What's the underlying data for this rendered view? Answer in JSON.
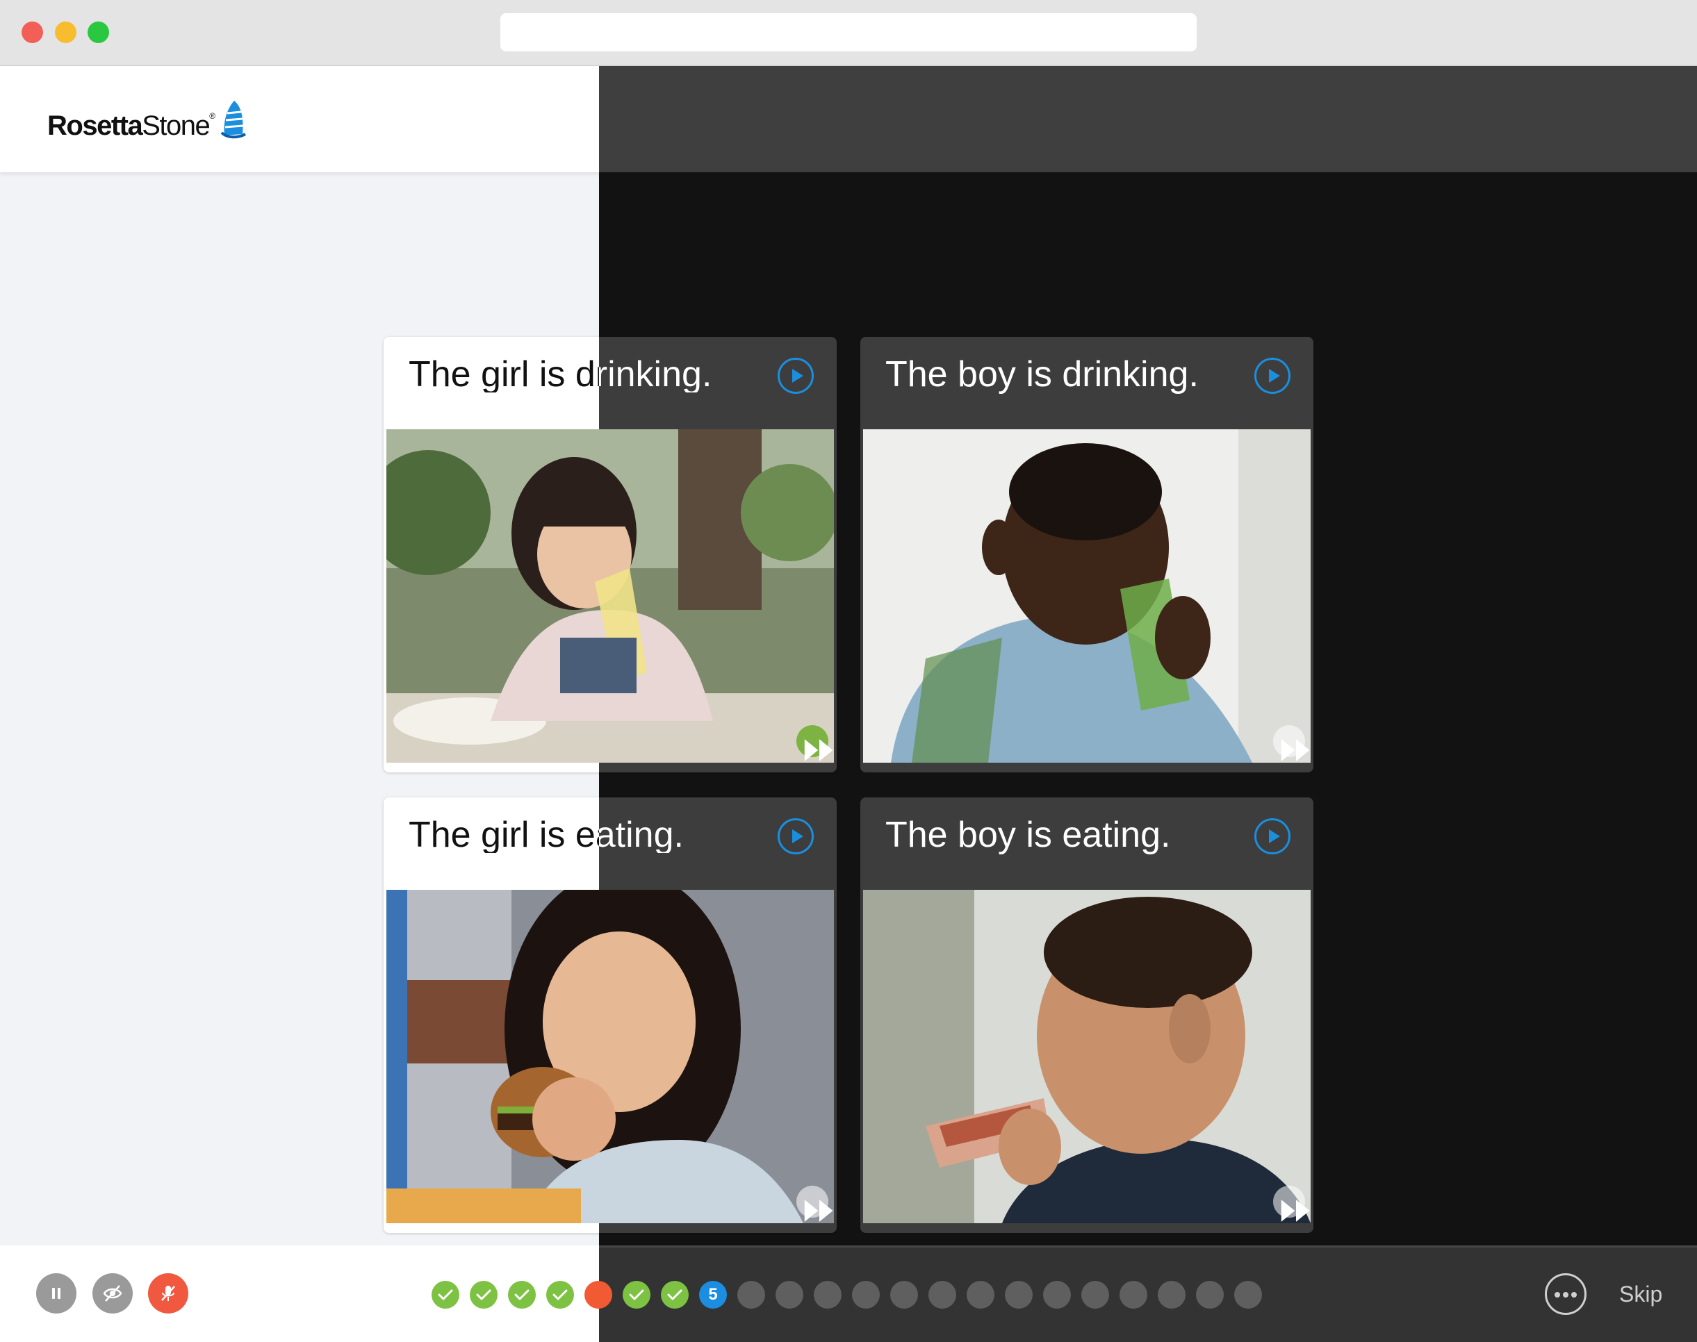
{
  "brand": {
    "logo_first": "Rosetta",
    "logo_second": "Stone",
    "logo_reg": "®",
    "accent_color": "#1b8ee2",
    "mark_color": "#1a8fe0"
  },
  "cards": [
    {
      "label": "The girl is drinking.",
      "play_icon": "play-circle-icon",
      "skip_icon": "fast-forward-icon"
    },
    {
      "label": "The boy is drinking.",
      "play_icon": "play-circle-icon",
      "skip_icon": "fast-forward-icon"
    },
    {
      "label": "The girl is eating.",
      "play_icon": "play-circle-icon",
      "skip_icon": "fast-forward-icon"
    },
    {
      "label": "The boy is eating.",
      "play_icon": "play-circle-icon",
      "skip_icon": "fast-forward-icon"
    }
  ],
  "footer": {
    "controls": [
      "pause-icon",
      "eye-off-icon",
      "mic-off-icon"
    ],
    "progress": [
      {
        "state": "done",
        "label": ""
      },
      {
        "state": "done",
        "label": ""
      },
      {
        "state": "done",
        "label": ""
      },
      {
        "state": "done",
        "label": ""
      },
      {
        "state": "wrong",
        "label": ""
      },
      {
        "state": "done",
        "label": ""
      },
      {
        "state": "done",
        "label": ""
      },
      {
        "state": "current",
        "label": "5"
      },
      {
        "state": "todo",
        "label": ""
      },
      {
        "state": "todo",
        "label": ""
      },
      {
        "state": "todo",
        "label": ""
      },
      {
        "state": "todo",
        "label": ""
      },
      {
        "state": "todo",
        "label": ""
      },
      {
        "state": "todo",
        "label": ""
      },
      {
        "state": "todo",
        "label": ""
      },
      {
        "state": "todo",
        "label": ""
      },
      {
        "state": "todo",
        "label": ""
      },
      {
        "state": "todo",
        "label": ""
      },
      {
        "state": "todo",
        "label": ""
      },
      {
        "state": "todo",
        "label": ""
      },
      {
        "state": "todo",
        "label": ""
      },
      {
        "state": "todo",
        "label": ""
      }
    ],
    "more_icon": "more-horizontal-icon",
    "skip_label": "Skip",
    "colors": {
      "done": "#7dc242",
      "wrong": "#f25a34",
      "current": "#1b8ee2",
      "todo": "#5f5f5f"
    }
  }
}
